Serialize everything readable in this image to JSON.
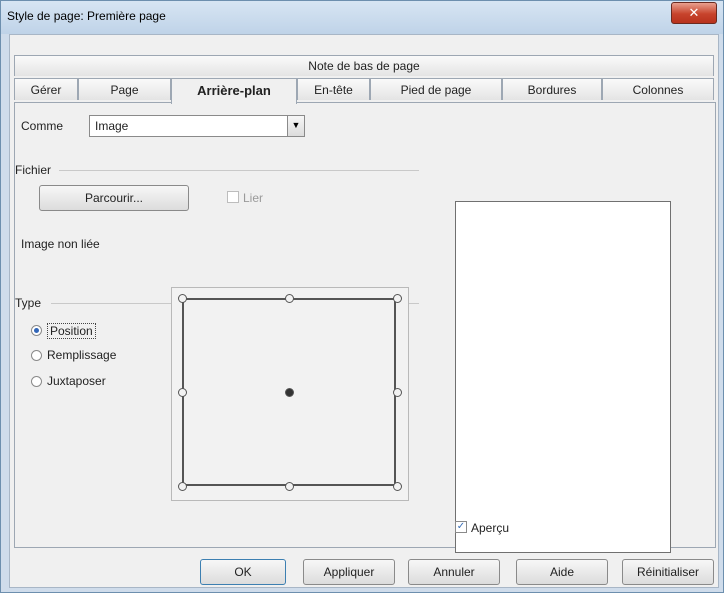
{
  "window": {
    "title": "Style de page: Première page",
    "close_symbol": "✕"
  },
  "tabs_top": {
    "label": "Note de bas de page"
  },
  "tabs": [
    {
      "label": "Gérer"
    },
    {
      "label": "Page"
    },
    {
      "label": "Arrière-plan"
    },
    {
      "label": "En-tête"
    },
    {
      "label": "Pied de page"
    },
    {
      "label": "Bordures"
    },
    {
      "label": "Colonnes"
    }
  ],
  "background": {
    "as_label": "Comme",
    "as_value": "Image",
    "file_group": "Fichier",
    "browse_label": "Parcourir...",
    "link_label": "Lier",
    "link_checked": false,
    "status": "Image non liée",
    "type_group": "Type",
    "options": [
      {
        "label": "Position",
        "selected": true
      },
      {
        "label": "Remplissage",
        "selected": false
      },
      {
        "label": "Juxtaposer",
        "selected": false
      }
    ],
    "preview_label": "Aperçu",
    "preview_checked": true
  },
  "buttons": {
    "ok": "OK",
    "apply": "Appliquer",
    "cancel": "Annuler",
    "help": "Aide",
    "reset": "Réinitialiser"
  },
  "icons": {
    "dropdown": "chevron-down-icon",
    "check": "checkmark-icon",
    "close": "close-icon"
  }
}
